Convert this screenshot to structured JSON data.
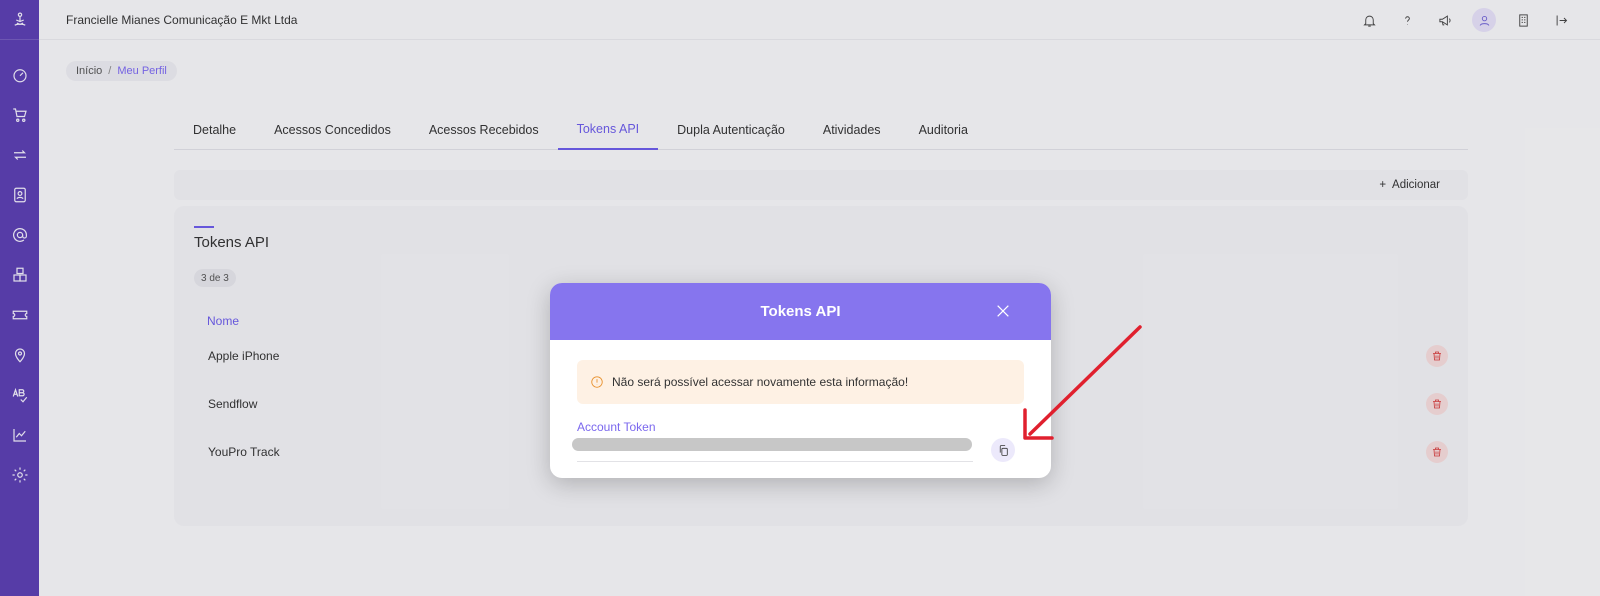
{
  "header": {
    "company": "Francielle Mianes Comunicação E Mkt Ltda",
    "icons": [
      "bell-icon",
      "help-icon",
      "megaphone-icon",
      "user-icon",
      "building-icon",
      "logout-icon"
    ]
  },
  "sidebar": {
    "icons": [
      "meditation-logo-icon",
      "dashboard-icon",
      "cart-icon",
      "transfer-icon",
      "contacts-icon",
      "at-icon",
      "boxes-icon",
      "ticket-icon",
      "location-icon",
      "spellcheck-icon",
      "chart-icon",
      "settings-icon"
    ]
  },
  "breadcrumb": {
    "home": "Início",
    "separator": "/",
    "current": "Meu Perfil"
  },
  "tabs": [
    {
      "label": "Detalhe"
    },
    {
      "label": "Acessos Concedidos"
    },
    {
      "label": "Acessos Recebidos"
    },
    {
      "label": "Tokens API",
      "active": true
    },
    {
      "label": "Dupla Autenticação"
    },
    {
      "label": "Atividades"
    },
    {
      "label": "Auditoria"
    }
  ],
  "toolbar": {
    "add_label": "Adicionar",
    "add_icon": "+"
  },
  "card": {
    "title": "Tokens API",
    "count": "3 de 3",
    "column_name": "Nome",
    "rows": [
      {
        "name": "Apple iPhone"
      },
      {
        "name": "Sendflow"
      },
      {
        "name": "YouPro Track"
      }
    ]
  },
  "modal": {
    "title": "Tokens API",
    "alert": "Não será possível acessar novamente esta informação!",
    "field_label": "Account Token",
    "token_value": "••••••••••••••••••••••••••••••••"
  },
  "colors": {
    "sidebar": "#5b3fb0",
    "accent": "#6c5ce7",
    "modal_header": "#8675ee",
    "alert_bg": "#fef1e4",
    "alert_icon": "#e8912d",
    "delete": "#d43a3a",
    "annotation_arrow": "#e0202e"
  }
}
